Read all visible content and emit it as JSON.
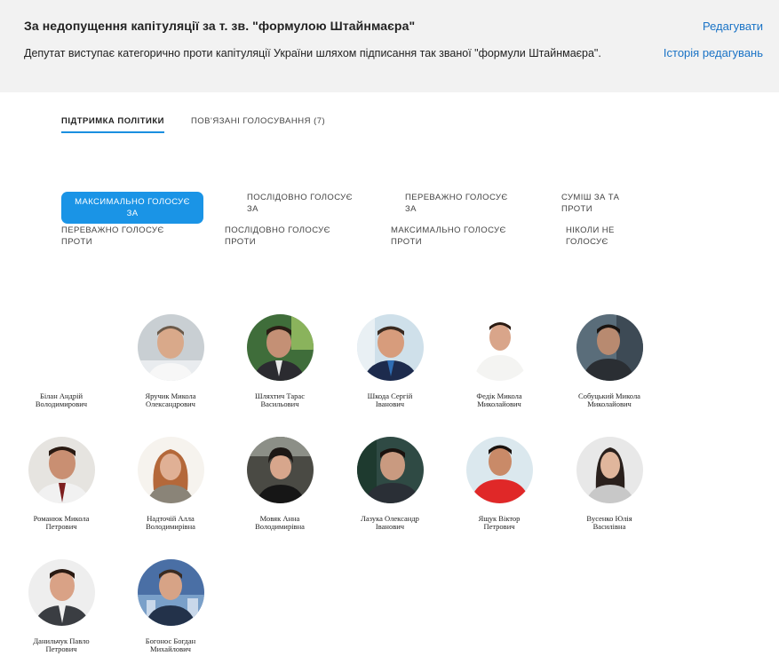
{
  "header": {
    "title": "За недопущення капітуляції за т. зв. \"формулою Штайнмаєра\"",
    "description": "Депутат виступає категорично проти капітуляції України шляхом підписання так званої \"формули Штайнмаєра\".",
    "edit_label": "Редагувати",
    "history_label": "Історія редагувань"
  },
  "tabs": [
    {
      "label": "ПІДТРИМКА ПОЛІТИКИ"
    },
    {
      "label": "ПОВ'ЯЗАНІ ГОЛОСУВАННЯ (7)"
    }
  ],
  "filters": [
    {
      "line1": "МАКСИМАЛЬНО ГОЛОСУЄ",
      "line2": "ЗА"
    },
    {
      "line1": "ПОСЛІДОВНО ГОЛОСУЄ",
      "line2": "ЗА"
    },
    {
      "line1": "ПЕРЕВАЖНО ГОЛОСУЄ",
      "line2": "ЗА"
    },
    {
      "line1": "СУМІШ ЗА ТА",
      "line2": "ПРОТИ"
    },
    {
      "line1": "ПЕРЕВАЖНО ГОЛОСУЄ",
      "line2": "ПРОТИ"
    },
    {
      "line1": "ПОСЛІДОВНО ГОЛОСУЄ",
      "line2": "ПРОТИ"
    },
    {
      "line1": "МАКСИМАЛЬНО ГОЛОСУЄ",
      "line2": "ПРОТИ"
    },
    {
      "line1": "НІКОЛИ НЕ",
      "line2": "ГОЛОСУЄ"
    }
  ],
  "people": [
    {
      "first": "Білан Андрій",
      "second": "Володимирович",
      "photo": false
    },
    {
      "first": "Яручик Микола",
      "second": "Олександрович",
      "photo": true
    },
    {
      "first": "Шляхтич Тарас",
      "second": "Васильович",
      "photo": true
    },
    {
      "first": "Шкода Сергій",
      "second": "Іванович",
      "photo": true
    },
    {
      "first": "Федік Микола",
      "second": "Миколайович",
      "photo": true
    },
    {
      "first": "Собуцький Микола",
      "second": "Миколайович",
      "photo": true
    },
    {
      "first": "Романюк Микола",
      "second": "Петрович",
      "photo": true
    },
    {
      "first": "Надточій Алла",
      "second": "Володимирівна",
      "photo": true
    },
    {
      "first": "Мовяк Анна",
      "second": "Володимирівна",
      "photo": true
    },
    {
      "first": "Лазука Олександр",
      "second": "Іванович",
      "photo": true
    },
    {
      "first": "Ящук Віктор",
      "second": "Петрович",
      "photo": true
    },
    {
      "first": "Вусенко Юлія",
      "second": "Василівна",
      "photo": true
    },
    {
      "first": "Данильчук Павло",
      "second": "Петрович",
      "photo": true
    },
    {
      "first": "Богонос Богдан",
      "second": "Михайлович",
      "photo": true
    }
  ],
  "colors": {
    "accent": "#1a94e6",
    "link": "#1a73c6",
    "header_bg": "#f2f2f2"
  }
}
